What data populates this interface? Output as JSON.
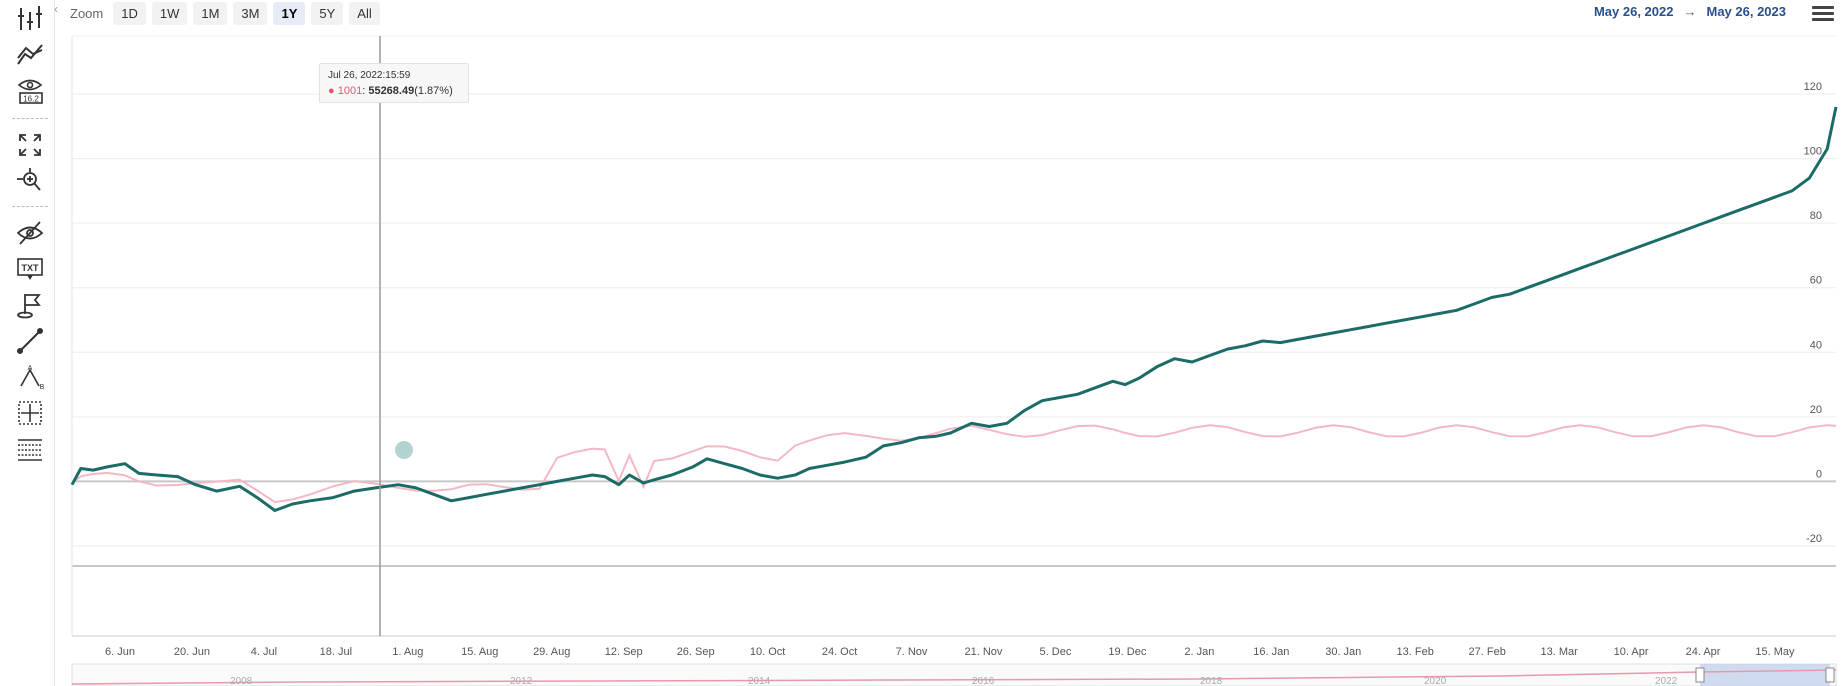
{
  "zoom": {
    "label": "Zoom",
    "buttons": [
      "1D",
      "1W",
      "1M",
      "3M",
      "1Y",
      "5Y",
      "All"
    ],
    "active": "1Y"
  },
  "range": {
    "from": "May 26, 2022",
    "arrow": "→",
    "to": "May 26, 2023"
  },
  "toolbar": {
    "tools": [
      "indicators-icon",
      "comparison-icon",
      "eye-value-icon",
      "fullscreen-icon",
      "zoom-pan-icon",
      "hide-icon",
      "text-annotation-icon",
      "flag-icon",
      "line-icon",
      "measure-icon",
      "crosshair-icon",
      "table-icon"
    ]
  },
  "tooltip": {
    "date": "Jul 26, 2022:15:59",
    "symbol": "1001",
    "value": "55268.49",
    "change": "(1.87%)"
  },
  "colors": {
    "main": "#1b6b66",
    "compare": "#f2b8c6",
    "navigator_fill": "#c5d3ee",
    "accent": "#2a4f8f"
  },
  "chart_data": {
    "type": "line",
    "y_ticks": [
      "120",
      "100",
      "80",
      "60",
      "40",
      "20",
      "0",
      "-20"
    ],
    "ylim": [
      -20,
      120
    ],
    "x_ticks": [
      "6. Jun",
      "20. Jun",
      "4. Jul",
      "18. Jul",
      "1. Aug",
      "15. Aug",
      "29. Aug",
      "12. Sep",
      "26. Sep",
      "10. Oct",
      "24. Oct",
      "7. Nov",
      "21. Nov",
      "5. Dec",
      "19. Dec",
      "2. Jan",
      "16. Jan",
      "30. Jan",
      "13. Feb",
      "27. Feb",
      "13. Mar",
      "10. Apr",
      "24. Apr",
      "15. May"
    ],
    "navigator_years": [
      "2008",
      "2012",
      "2014",
      "2016",
      "2018",
      "2020",
      "2022"
    ],
    "series": [
      {
        "values": [
          [
            0,
            -1
          ],
          [
            0.5,
            4
          ],
          [
            1.2,
            3.5
          ],
          [
            2,
            4.5
          ],
          [
            3,
            5.5
          ],
          [
            3.8,
            2.5
          ],
          [
            4.8,
            2
          ],
          [
            6,
            1.5
          ],
          [
            7,
            -1
          ],
          [
            8.2,
            -3
          ],
          [
            9.5,
            -1.5
          ],
          [
            10.5,
            -5
          ],
          [
            11.5,
            -9
          ],
          [
            12.5,
            -7
          ],
          [
            13.5,
            -6
          ],
          [
            14.8,
            -5
          ],
          [
            16,
            -3
          ],
          [
            17.2,
            -2
          ],
          [
            18.5,
            -1
          ],
          [
            19.5,
            -2
          ],
          [
            20.5,
            -4
          ],
          [
            21.5,
            -6
          ],
          [
            22.5,
            -5
          ],
          [
            23.5,
            -4
          ],
          [
            24.5,
            -3
          ],
          [
            25.5,
            -2
          ],
          [
            26.5,
            -1
          ],
          [
            27.5,
            0
          ],
          [
            28.5,
            1
          ],
          [
            29.5,
            2
          ],
          [
            30.2,
            1.5
          ],
          [
            31,
            -1
          ],
          [
            31.6,
            2
          ],
          [
            32.4,
            -0.5
          ],
          [
            33,
            0.5
          ],
          [
            34,
            2
          ],
          [
            35.2,
            4.5
          ],
          [
            36,
            7
          ],
          [
            37,
            5.5
          ],
          [
            38,
            4
          ],
          [
            39,
            2
          ],
          [
            40,
            1
          ],
          [
            41,
            2
          ],
          [
            41.8,
            4
          ],
          [
            42.8,
            5
          ],
          [
            43.8,
            6
          ],
          [
            45,
            7.5
          ],
          [
            46,
            11
          ],
          [
            47,
            12
          ],
          [
            48,
            13.5
          ],
          [
            49,
            14
          ],
          [
            49.8,
            15
          ],
          [
            51,
            18
          ],
          [
            52,
            17
          ],
          [
            53,
            18
          ],
          [
            54,
            22
          ],
          [
            55,
            25
          ],
          [
            56,
            26
          ],
          [
            57,
            27
          ],
          [
            58,
            29
          ],
          [
            59,
            31
          ],
          [
            59.7,
            30
          ],
          [
            60.5,
            32
          ],
          [
            61.5,
            35.5
          ],
          [
            62.5,
            38
          ],
          [
            63.5,
            37
          ],
          [
            64.5,
            39
          ],
          [
            65.5,
            41
          ],
          [
            66.5,
            42
          ],
          [
            67.5,
            43.5
          ],
          [
            68.5,
            43
          ],
          [
            69.5,
            44
          ],
          [
            70.5,
            45
          ],
          [
            71.5,
            46
          ],
          [
            72.5,
            47
          ],
          [
            73.5,
            48
          ],
          [
            74.5,
            49
          ],
          [
            75.5,
            50
          ],
          [
            76.5,
            51
          ],
          [
            77.5,
            52
          ],
          [
            78.5,
            53
          ],
          [
            79.5,
            55
          ],
          [
            80.5,
            57
          ],
          [
            81.5,
            58
          ],
          [
            82.5,
            60
          ],
          [
            83.5,
            62
          ],
          [
            84.5,
            64
          ],
          [
            85.5,
            66
          ],
          [
            86.5,
            68
          ],
          [
            87.5,
            70
          ],
          [
            88.5,
            72
          ],
          [
            89.5,
            74
          ],
          [
            90.5,
            76
          ],
          [
            91.5,
            78
          ],
          [
            92.5,
            80
          ],
          [
            93.5,
            82
          ],
          [
            94.5,
            84
          ],
          [
            95.5,
            86
          ],
          [
            96.5,
            88
          ],
          [
            97.5,
            90
          ],
          [
            98.5,
            94
          ],
          [
            99.5,
            103
          ],
          [
            100,
            116
          ]
        ]
      }
    ]
  }
}
